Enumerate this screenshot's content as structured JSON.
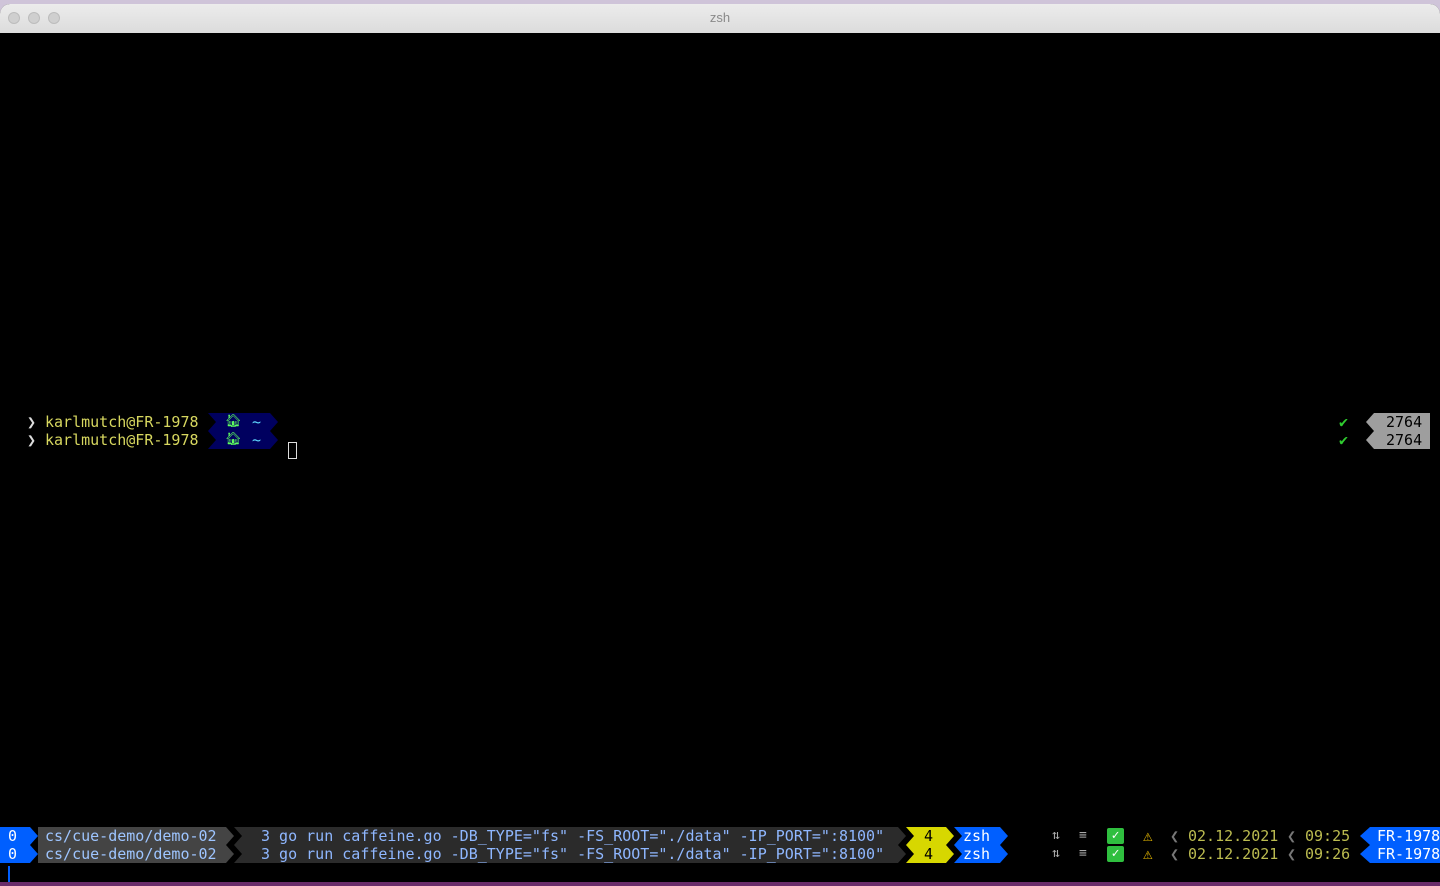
{
  "window": {
    "title": "zsh"
  },
  "prompt_lines": [
    {
      "user_host": "karlmutch@FR-1978",
      "dir": "~",
      "status": "✔",
      "pid": "2764"
    },
    {
      "user_host": "karlmutch@FR-1978",
      "dir": "~",
      "status": "✔",
      "pid": "2764"
    }
  ],
  "status_lines": [
    {
      "index": "0",
      "path": "cs/cue-demo/demo-02",
      "command": "3 go run caffeine.go -DB_TYPE=\"fs\" -FS_ROOT=\"./data\" -IP_PORT=\":8100\"",
      "window_num": "4",
      "window_name": "zsh",
      "sync": "⇅",
      "menu": "≡",
      "check": "✓",
      "warn": "⚠",
      "date": "02.12.2021",
      "time": "09:25",
      "host": "FR-1978"
    },
    {
      "index": "0",
      "path": "cs/cue-demo/demo-02",
      "command": "3 go run caffeine.go -DB_TYPE=\"fs\" -FS_ROOT=\"./data\" -IP_PORT=\":8100\"",
      "window_num": "4",
      "window_name": "zsh",
      "sync": "⇅",
      "menu": "≡",
      "check": "✓",
      "warn": "⚠",
      "date": "02.12.2021",
      "time": "09:26",
      "host": "FR-1978"
    }
  ],
  "icons": {
    "apple": "apple-icon",
    "home": "home-icon",
    "prompt_chevron": "chevron-right-icon"
  },
  "colors": {
    "background": "#000000",
    "user": "#d7d75f",
    "accent_blue": "#005fff",
    "ok_green": "#2fcc2f",
    "warn_yellow": "#f0c000"
  }
}
